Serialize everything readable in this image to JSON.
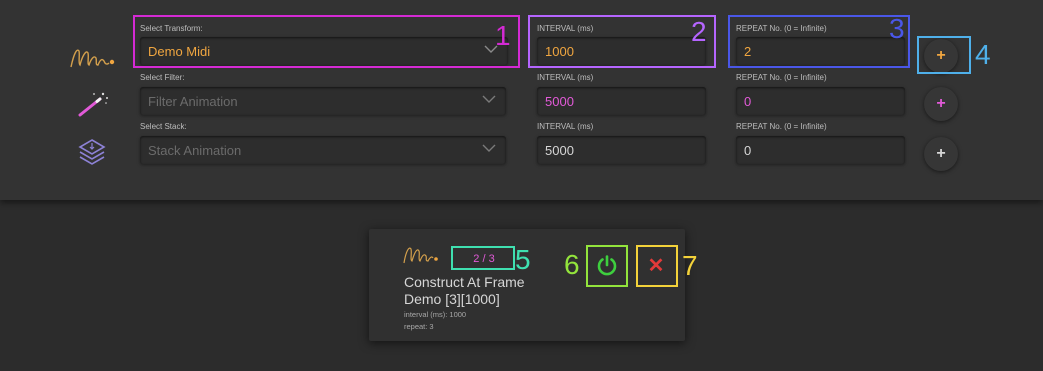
{
  "rows": [
    {
      "icon": "midi-signature-icon",
      "select_label": "Select Transform:",
      "select_value": "Demo Midi",
      "interval_label": "INTERVAL (ms)",
      "interval_value": "1000",
      "repeat_label": "REPEAT No. (0 = Infinite)",
      "repeat_value": "2",
      "add_label": "+"
    },
    {
      "icon": "magic-wand-icon",
      "select_label": "Select Filter:",
      "select_value": "Filter Animation",
      "interval_label": "INTERVAL (ms)",
      "interval_value": "5000",
      "repeat_label": "REPEAT No. (0 = Infinite)",
      "repeat_value": "0",
      "add_label": "+"
    },
    {
      "icon": "layers-stack-icon",
      "select_label": "Select Stack:",
      "select_value": "Stack Animation",
      "interval_label": "INTERVAL (ms)",
      "interval_value": "5000",
      "repeat_label": "REPEAT No. (0 = Infinite)",
      "repeat_value": "0",
      "add_label": "+"
    }
  ],
  "card": {
    "icon": "midi-signature-icon",
    "counter": "2 / 3",
    "title_line1": "Construct At Frame",
    "title_line2": "Demo [3][1000]",
    "interval_text": "interval (ms): 1000",
    "repeat_text": "repeat: 3",
    "power_icon": "power-icon",
    "delete_label": "✕"
  },
  "annotations": [
    "1",
    "2",
    "3",
    "4",
    "5",
    "6",
    "7"
  ],
  "colors": {
    "accent_orange": "#f0a640",
    "accent_magenta": "#e25ad8",
    "accent_green": "#3ecf3e",
    "accent_red": "#e23a3a",
    "ann1": "#d42ad4",
    "ann2": "#b565ff",
    "ann3": "#4a57e8",
    "ann4": "#4fb0ea",
    "ann5": "#3fe0b0",
    "ann6": "#93e43c",
    "ann7": "#f3d23a"
  }
}
